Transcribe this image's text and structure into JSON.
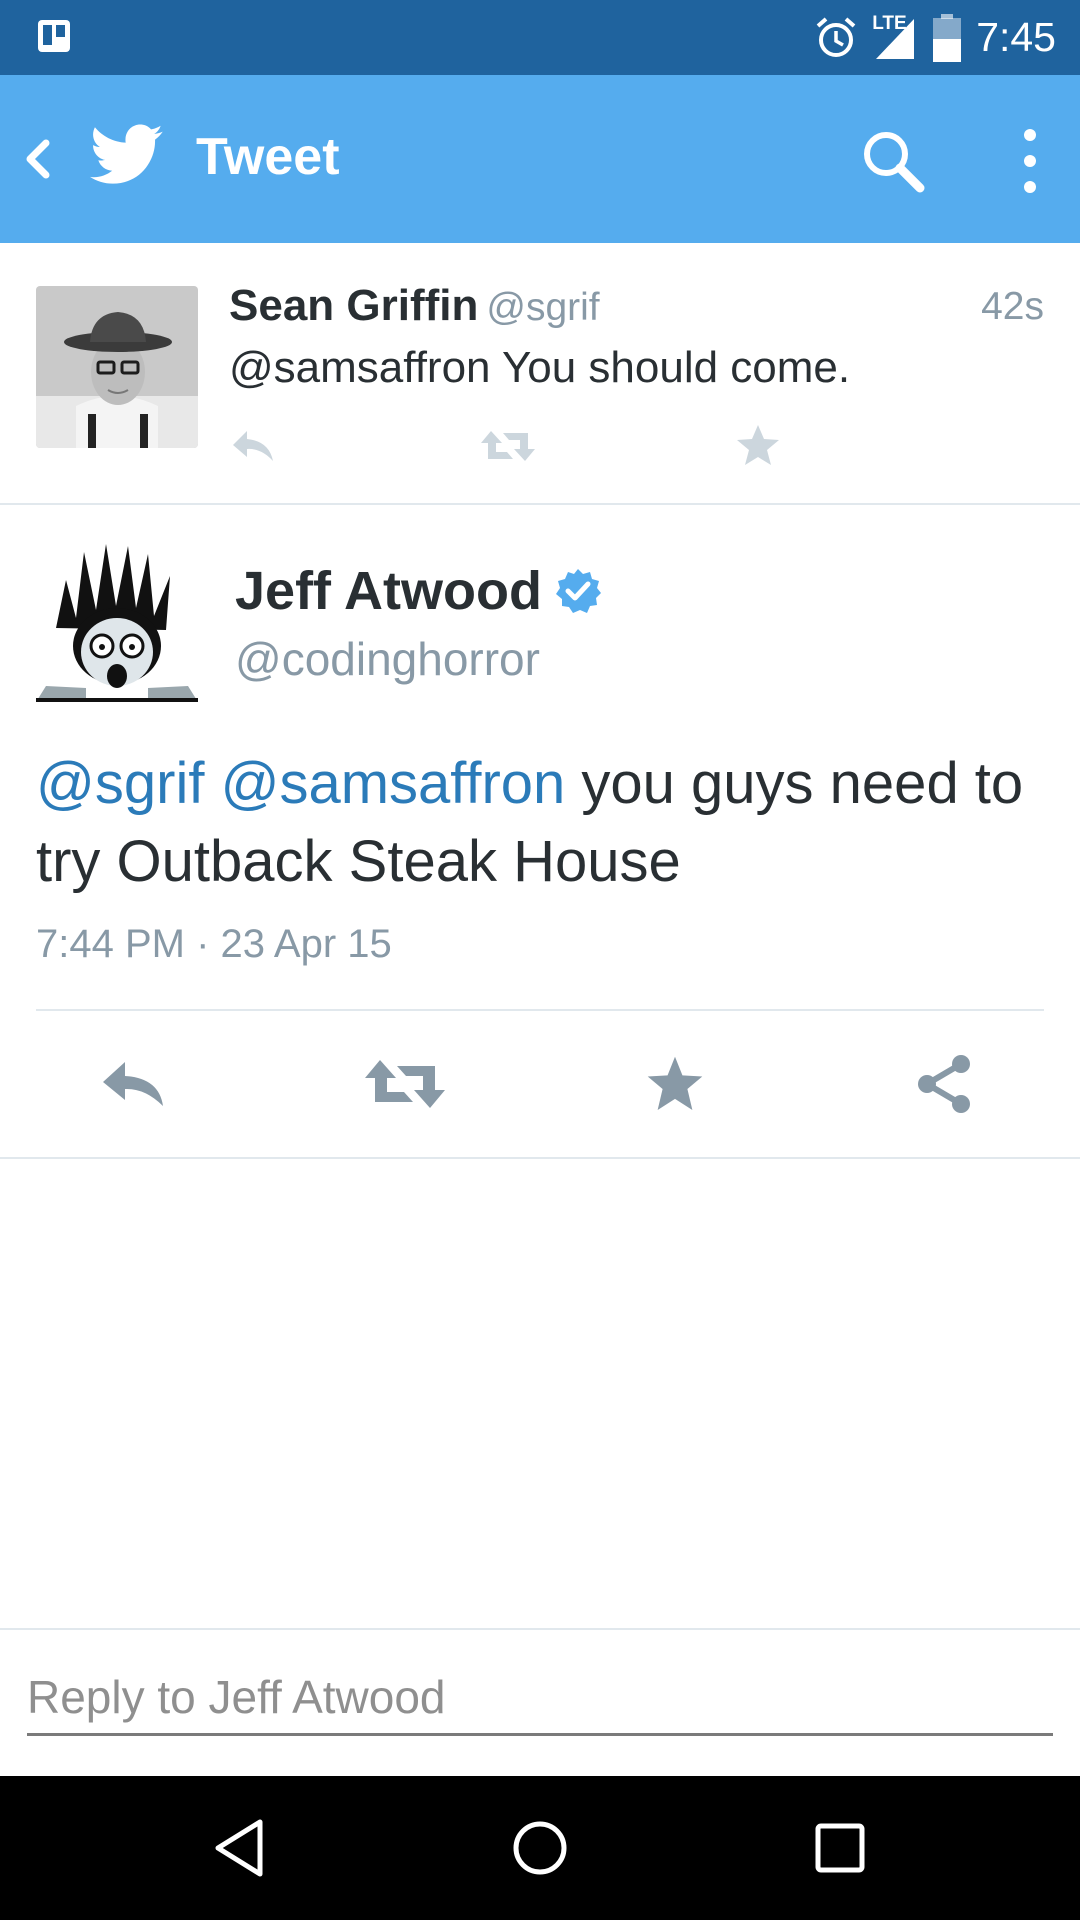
{
  "status_bar": {
    "time": "7:45",
    "network": "LTE",
    "icons": [
      "trello-icon",
      "alarm-icon",
      "signal-icon",
      "battery-icon"
    ]
  },
  "action_bar": {
    "title": "Tweet",
    "icons": [
      "back-icon",
      "twitter-bird-icon",
      "search-icon",
      "overflow-menu-icon"
    ],
    "background": "#55acee"
  },
  "previous_tweet": {
    "name": "Sean Griffin",
    "handle": "@sgrif",
    "time": "42s",
    "text": "@samsaffron You should come.",
    "actions": [
      "reply-icon",
      "retweet-icon",
      "favorite-icon"
    ]
  },
  "main_tweet": {
    "name": "Jeff Atwood",
    "verified": true,
    "handle": "@codinghorror",
    "mention_1": "@sgrif",
    "mention_2": "@samsaffron",
    "text_rest": " you guys need to try Outback Steak House",
    "date": "7:44 PM · 23 Apr 15",
    "actions": [
      "reply-icon",
      "retweet-icon",
      "favorite-icon",
      "share-icon"
    ]
  },
  "reply": {
    "placeholder": "Reply to Jeff Atwood"
  },
  "nav_bar": {
    "buttons": [
      "back-triangle-icon",
      "home-circle-icon",
      "recents-square-icon"
    ]
  },
  "colors": {
    "status_bar": "#1f639e",
    "accent": "#55acee",
    "mention": "#2b7bb9",
    "muted": "#8899a6",
    "text": "#292f33"
  }
}
